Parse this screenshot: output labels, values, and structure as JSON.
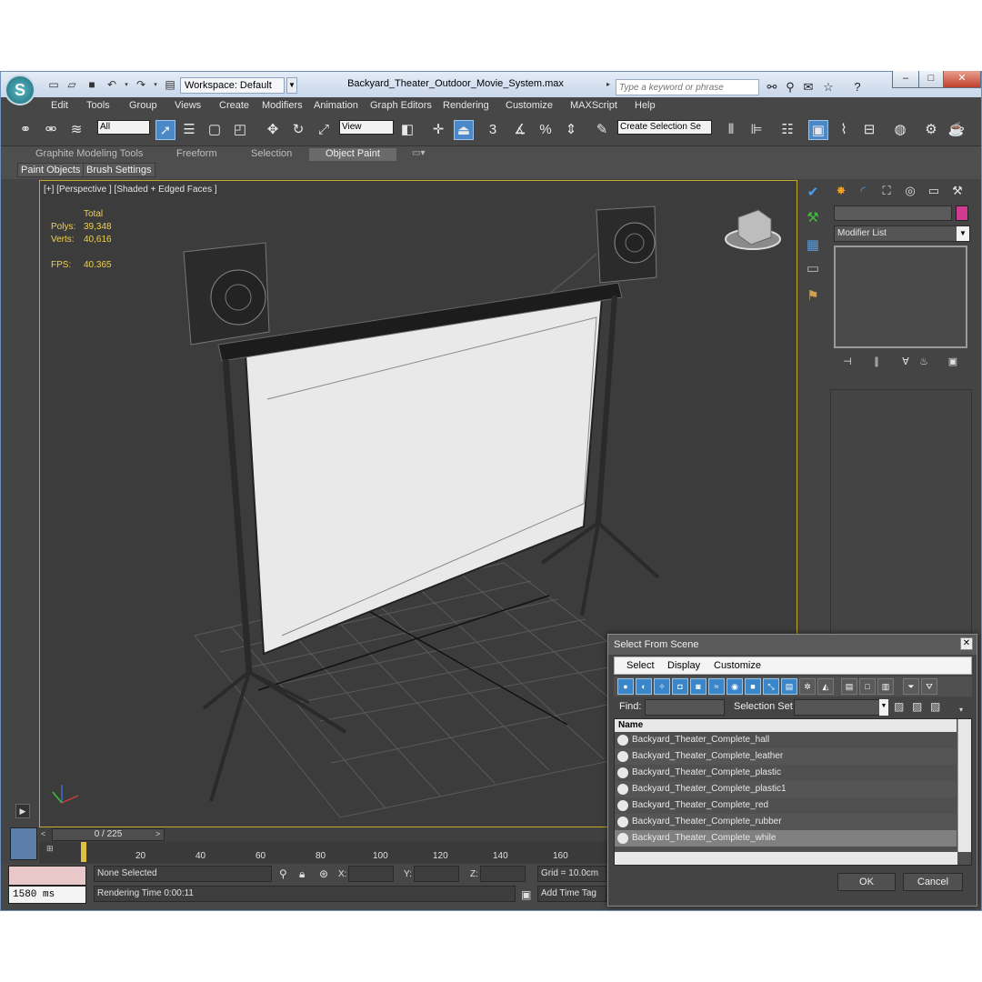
{
  "window": {
    "title": "Backyard_Theater_Outdoor_Movie_System.max",
    "workspace": "Workspace: Default",
    "search_placeholder": "Type a keyword or phrase"
  },
  "menu": [
    "Edit",
    "Tools",
    "Group",
    "Views",
    "Create",
    "Modifiers",
    "Animation",
    "Graph Editors",
    "Rendering",
    "Customize",
    "MAXScript",
    "Help"
  ],
  "toolbar": {
    "selection_filter": "All",
    "ref_coord": "View",
    "selection_set": "Create Selection Se",
    "snap_labels": [
      "3",
      "%"
    ]
  },
  "ribbon": {
    "tabs": [
      "Graphite Modeling Tools",
      "Freeform",
      "Selection",
      "Object Paint"
    ],
    "active_tab": "Object Paint",
    "subtabs": [
      "Paint Objects",
      "Brush Settings"
    ]
  },
  "viewport": {
    "label": "[+] [Perspective ] [Shaded + Edged Faces ]",
    "stats_header": "Total",
    "polys_label": "Polys:",
    "polys": "39,348",
    "verts_label": "Verts:",
    "verts": "40,616",
    "fps_label": "FPS:",
    "fps": "40.365"
  },
  "command_panel": {
    "modifier_list": "Modifier List",
    "object_color": "#d03b8f"
  },
  "timeline": {
    "frame_display": "0 / 225",
    "ticks": [
      "20",
      "40",
      "60",
      "80",
      "100",
      "120",
      "140",
      "160"
    ]
  },
  "status": {
    "render_ms": "1580 ms",
    "selection": "None Selected",
    "rendering_time": "Rendering Time  0:00:11",
    "x_label": "X:",
    "y_label": "Y:",
    "z_label": "Z:",
    "grid": "Grid = 10.0cm",
    "add_time_tag": "Add Time Tag"
  },
  "dialog": {
    "title": "Select From Scene",
    "menu": [
      "Select",
      "Display",
      "Customize"
    ],
    "find_label": "Find:",
    "selection_set_label": "Selection Set:",
    "column_name": "Name",
    "items": [
      "Backyard_Theater_Complete_hall",
      "Backyard_Theater_Complete_leather",
      "Backyard_Theater_Complete_plastic",
      "Backyard_Theater_Complete_plastic1",
      "Backyard_Theater_Complete_red",
      "Backyard_Theater_Complete_rubber",
      "Backyard_Theater_Complete_while"
    ],
    "ok": "OK",
    "cancel": "Cancel"
  }
}
